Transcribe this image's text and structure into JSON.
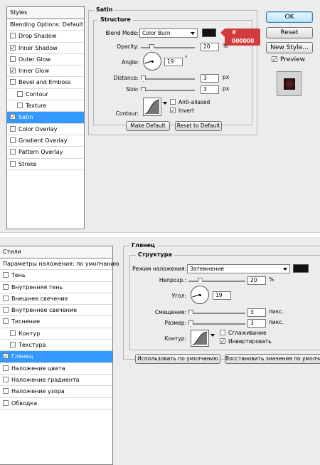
{
  "en": {
    "sidebar": {
      "header": "Styles",
      "items": [
        {
          "label": "Blending Options: Default",
          "check": "none",
          "selected": false,
          "indent": false
        },
        {
          "label": "Drop Shadow",
          "check": "off",
          "selected": false,
          "indent": false
        },
        {
          "label": "Inner Shadow",
          "check": "on",
          "selected": false,
          "indent": false
        },
        {
          "label": "Outer Glow",
          "check": "off",
          "selected": false,
          "indent": false
        },
        {
          "label": "Inner Glow",
          "check": "on",
          "selected": false,
          "indent": false
        },
        {
          "label": "Bevel and Emboss",
          "check": "off",
          "selected": false,
          "indent": false
        },
        {
          "label": "Contour",
          "check": "off",
          "selected": false,
          "indent": true
        },
        {
          "label": "Texture",
          "check": "off",
          "selected": false,
          "indent": true
        },
        {
          "label": "Satin",
          "check": "on",
          "selected": true,
          "indent": false
        },
        {
          "label": "Color Overlay",
          "check": "off",
          "selected": false,
          "indent": false
        },
        {
          "label": "Gradient Overlay",
          "check": "off",
          "selected": false,
          "indent": false
        },
        {
          "label": "Pattern Overlay",
          "check": "off",
          "selected": false,
          "indent": false
        },
        {
          "label": "Stroke",
          "check": "off",
          "selected": false,
          "indent": false
        }
      ]
    },
    "panel": {
      "title": "Satin",
      "group_title": "Structure",
      "blend_mode_label": "Blend Mode:",
      "blend_mode_value": "Color Burn",
      "color_hex_tag": "# 000000",
      "opacity_label": "Opacity:",
      "opacity_value": "20",
      "opacity_unit": "%",
      "angle_label": "Angle:",
      "angle_value": "19",
      "angle_unit": "°",
      "distance_label": "Distance:",
      "distance_value": "3",
      "distance_unit": "px",
      "size_label": "Size:",
      "size_value": "3",
      "size_unit": "px",
      "contour_label": "Contour:",
      "anti_aliased_label": "Anti-aliased",
      "anti_aliased_checked": false,
      "invert_label": "Invert",
      "invert_checked": true,
      "make_default_label": "Make Default",
      "reset_default_label": "Reset to Default"
    },
    "right": {
      "ok_label": "OK",
      "reset_label": "Reset",
      "new_style_label": "New Style...",
      "preview_label": "Preview",
      "preview_checked": true
    }
  },
  "ru": {
    "sidebar": {
      "header": "Стили",
      "items": [
        {
          "label": "Параметры наложения: по умолчанию",
          "check": "none",
          "selected": false,
          "indent": false
        },
        {
          "label": "Тень",
          "check": "off",
          "selected": false,
          "indent": false
        },
        {
          "label": "Внутренняя тень",
          "check": "off",
          "selected": false,
          "indent": false
        },
        {
          "label": "Внешнее свечение",
          "check": "off",
          "selected": false,
          "indent": false
        },
        {
          "label": "Внутреннее свечение",
          "check": "off",
          "selected": false,
          "indent": false
        },
        {
          "label": "Тиснение",
          "check": "off",
          "selected": false,
          "indent": false
        },
        {
          "label": "Контур",
          "check": "off",
          "selected": false,
          "indent": true
        },
        {
          "label": "Текстура",
          "check": "off",
          "selected": false,
          "indent": true
        },
        {
          "label": "Глянец",
          "check": "on",
          "selected": true,
          "indent": false
        },
        {
          "label": "Наложение цвета",
          "check": "off",
          "selected": false,
          "indent": false
        },
        {
          "label": "Наложение градиента",
          "check": "off",
          "selected": false,
          "indent": false
        },
        {
          "label": "Наложение узора",
          "check": "off",
          "selected": false,
          "indent": false
        },
        {
          "label": "Обводка",
          "check": "off",
          "selected": false,
          "indent": false
        }
      ]
    },
    "panel": {
      "title": "Глянец",
      "group_title": "Структура",
      "blend_mode_label": "Режим наложения:",
      "blend_mode_value": "Затемнение",
      "opacity_label": "Непрозр.:",
      "opacity_value": "20",
      "opacity_unit": "%",
      "angle_label": "Угол:",
      "angle_value": "19",
      "distance_label": "Смещение:",
      "distance_value": "3",
      "distance_unit": "пикс.",
      "size_label": "Размер:",
      "size_value": "3",
      "size_unit": "пикс.",
      "contour_label": "Контур:",
      "anti_aliased_label": "Сглаживание",
      "anti_aliased_checked": false,
      "invert_label": "Инвертировать",
      "invert_checked": true,
      "make_default_label": "Использовать по умолчанию",
      "reset_default_label": "Восстановить значения по умолчанию"
    }
  },
  "sliders": {
    "opacity_percent": 20,
    "angle_degrees": 19,
    "distance_fraction": 0.02,
    "size_fraction": 0.02
  },
  "colors": {
    "accent_selected": "#3399ff",
    "shadow_color": "#000000",
    "tag_red": "#d23b3b"
  },
  "icons": [
    "checkbox-icon",
    "dropdown-arrow-icon",
    "angle-dial-icon",
    "slider-thumb-icon",
    "contour-curve-icon"
  ]
}
